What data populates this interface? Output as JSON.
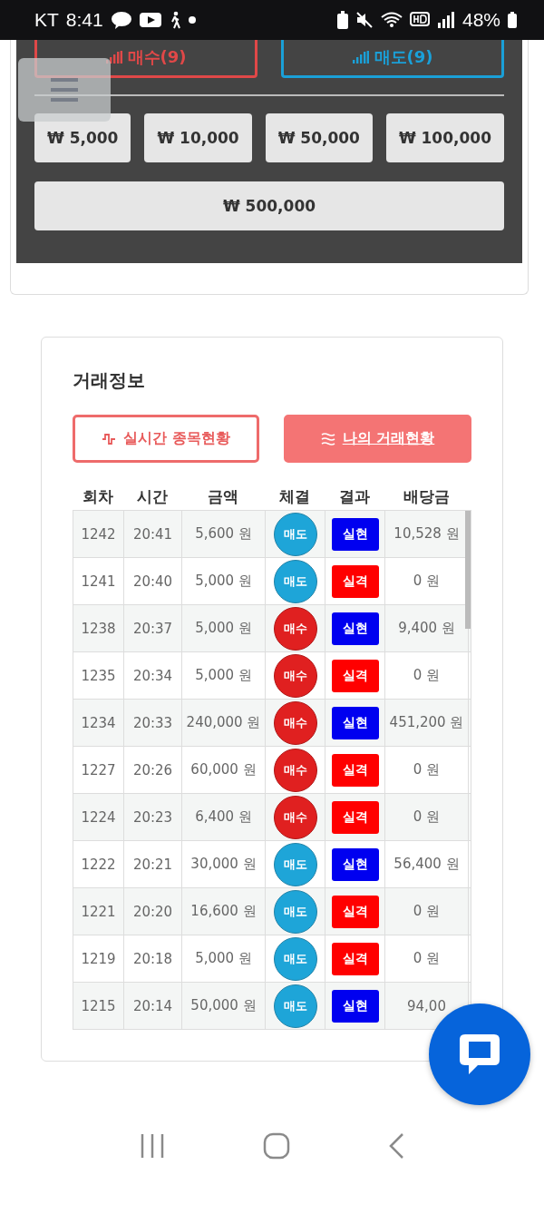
{
  "status_bar": {
    "carrier": "KT",
    "time": "8:41",
    "battery": "48%"
  },
  "order_panel": {
    "sides": [
      {
        "label": "매수(9)",
        "kind": "buy"
      },
      {
        "label": "매도(9)",
        "kind": "sell"
      }
    ],
    "amounts": [
      "₩ 5,000",
      "₩ 10,000",
      "₩ 50,000",
      "₩ 100,000"
    ],
    "wide_amount": "₩ 500,000"
  },
  "trade_info": {
    "title": "거래정보",
    "tabs": [
      {
        "label": "실시간 종목현황",
        "kind": "pulse",
        "selected": false
      },
      {
        "label": "나의 거래현황",
        "kind": "list",
        "selected": true
      }
    ],
    "table": {
      "columns": [
        "회차",
        "시간",
        "금액",
        "체결",
        "결과",
        "배당금"
      ],
      "rows": [
        {
          "round": "1242",
          "time": "20:41",
          "amount": "5,600 원",
          "trade": {
            "label": "매도",
            "kind": "sell"
          },
          "result": {
            "label": "실현",
            "kind": "win"
          },
          "payout": "10,528 원"
        },
        {
          "round": "1241",
          "time": "20:40",
          "amount": "5,000 원",
          "trade": {
            "label": "매도",
            "kind": "sell"
          },
          "result": {
            "label": "실격",
            "kind": "lose"
          },
          "payout": "0 원"
        },
        {
          "round": "1238",
          "time": "20:37",
          "amount": "5,000 원",
          "trade": {
            "label": "매수",
            "kind": "buy"
          },
          "result": {
            "label": "실현",
            "kind": "win"
          },
          "payout": "9,400 원"
        },
        {
          "round": "1235",
          "time": "20:34",
          "amount": "5,000 원",
          "trade": {
            "label": "매수",
            "kind": "buy"
          },
          "result": {
            "label": "실격",
            "kind": "lose"
          },
          "payout": "0 원"
        },
        {
          "round": "1234",
          "time": "20:33",
          "amount": "240,000 원",
          "trade": {
            "label": "매수",
            "kind": "buy"
          },
          "result": {
            "label": "실현",
            "kind": "win"
          },
          "payout": "451,200 원"
        },
        {
          "round": "1227",
          "time": "20:26",
          "amount": "60,000 원",
          "trade": {
            "label": "매수",
            "kind": "buy"
          },
          "result": {
            "label": "실격",
            "kind": "lose"
          },
          "payout": "0 원"
        },
        {
          "round": "1224",
          "time": "20:23",
          "amount": "6,400 원",
          "trade": {
            "label": "매수",
            "kind": "buy"
          },
          "result": {
            "label": "실격",
            "kind": "lose"
          },
          "payout": "0 원"
        },
        {
          "round": "1222",
          "time": "20:21",
          "amount": "30,000 원",
          "trade": {
            "label": "매도",
            "kind": "sell"
          },
          "result": {
            "label": "실현",
            "kind": "win"
          },
          "payout": "56,400 원"
        },
        {
          "round": "1221",
          "time": "20:20",
          "amount": "16,600 원",
          "trade": {
            "label": "매도",
            "kind": "sell"
          },
          "result": {
            "label": "실격",
            "kind": "lose"
          },
          "payout": "0 원"
        },
        {
          "round": "1219",
          "time": "20:18",
          "amount": "5,000 원",
          "trade": {
            "label": "매도",
            "kind": "sell"
          },
          "result": {
            "label": "실격",
            "kind": "lose"
          },
          "payout": "0 원"
        },
        {
          "round": "1215",
          "time": "20:14",
          "amount": "50,000 원",
          "trade": {
            "label": "매도",
            "kind": "sell"
          },
          "result": {
            "label": "실현",
            "kind": "win"
          },
          "payout": "94,00"
        }
      ]
    }
  }
}
